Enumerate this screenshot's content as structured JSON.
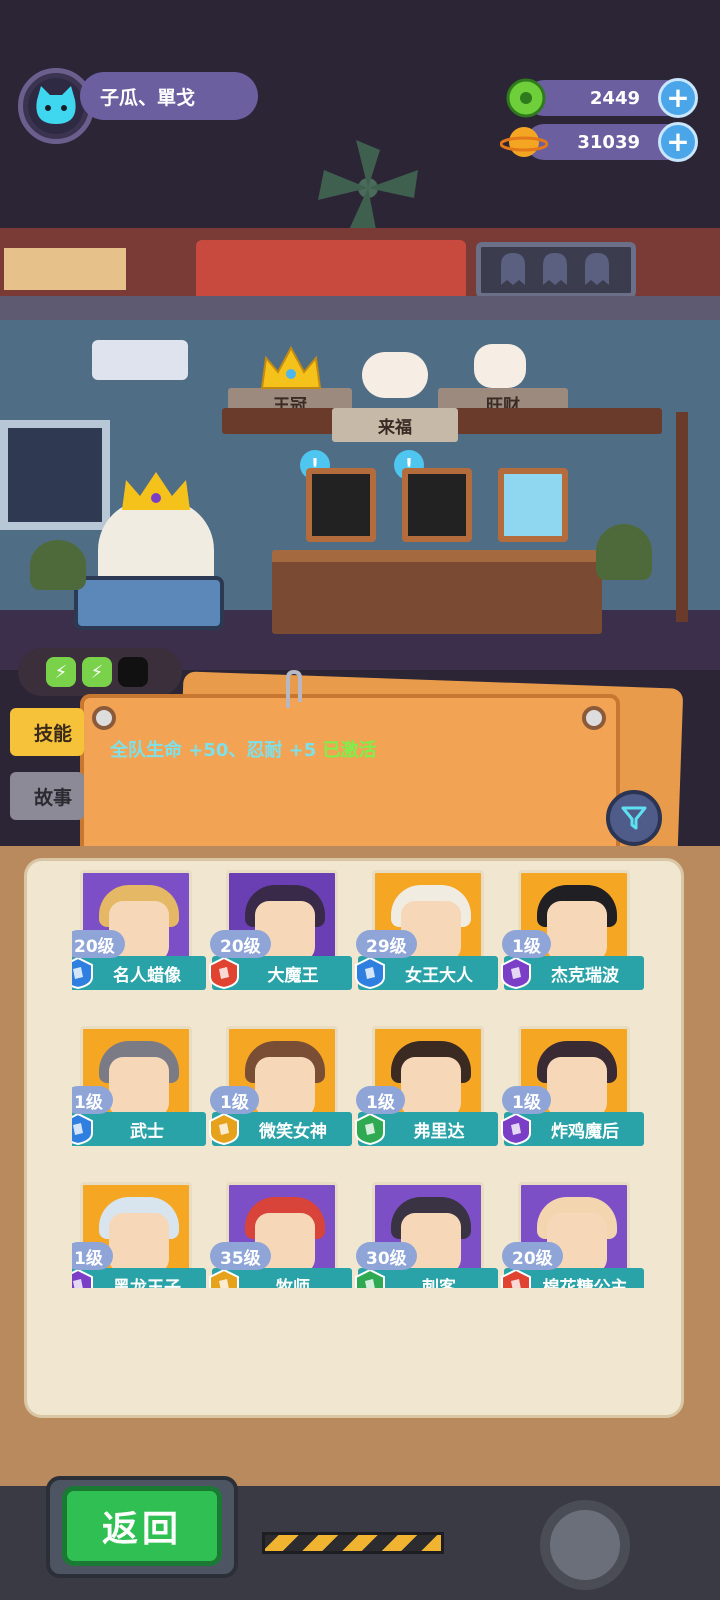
{
  "player": {
    "name": "子瓜、單戈"
  },
  "currency": {
    "gems": {
      "value": "2449",
      "icon": "donut-icon",
      "color": "#6fcf3a"
    },
    "coins": {
      "value": "31039",
      "icon": "planet-coin-icon",
      "color": "#f4a622"
    }
  },
  "shelf": {
    "left_plank": "王冠",
    "center_plank": "来福",
    "right_plank": "旺财"
  },
  "energy": {
    "filled": 2,
    "total": 3
  },
  "tabs": {
    "skill": "技能",
    "story": "故事",
    "active": "skill"
  },
  "skill": {
    "text": "全队生命 +50、忍耐 +5 ",
    "status": "已激活"
  },
  "characters": [
    {
      "level": "20级",
      "name": "名人蜡像",
      "badge": "blue",
      "bg": "#7d4fc7",
      "hair": "#e4b864"
    },
    {
      "level": "20级",
      "name": "大魔王",
      "badge": "red",
      "bg": "#6a3fb3",
      "hair": "#3a2a4a"
    },
    {
      "level": "29级",
      "name": "女王大人",
      "badge": "blue",
      "bg": "#f5a623",
      "hair": "#f1ece2"
    },
    {
      "level": "1级",
      "name": "杰克瑞波",
      "badge": "purple",
      "bg": "#f5a623",
      "hair": "#1f1f24"
    },
    {
      "level": "1级",
      "name": "武士",
      "badge": "blue",
      "bg": "#f5a623",
      "hair": "#7b7b86"
    },
    {
      "level": "1级",
      "name": "微笑女神",
      "badge": "gold",
      "bg": "#f5a623",
      "hair": "#7a4e34"
    },
    {
      "level": "1级",
      "name": "弗里达",
      "badge": "green",
      "bg": "#f5a623",
      "hair": "#3b2a22"
    },
    {
      "level": "1级",
      "name": "炸鸡魔后",
      "badge": "purple",
      "bg": "#f5a623",
      "hair": "#3a2a33"
    },
    {
      "level": "1级",
      "name": "黑龙王子",
      "badge": "purple",
      "bg": "#f5a623",
      "hair": "#d8e4ee"
    },
    {
      "level": "35级",
      "name": "牧师",
      "badge": "gold",
      "bg": "#7d4fc7",
      "hair": "#d8433a"
    },
    {
      "level": "30级",
      "name": "刺客",
      "badge": "green",
      "bg": "#7d4fc7",
      "hair": "#3a3344"
    },
    {
      "level": "20级",
      "name": "棉花糖公主",
      "badge": "red",
      "bg": "#7d4fc7",
      "hair": "#f3d6b0"
    }
  ],
  "back_button": "返回"
}
